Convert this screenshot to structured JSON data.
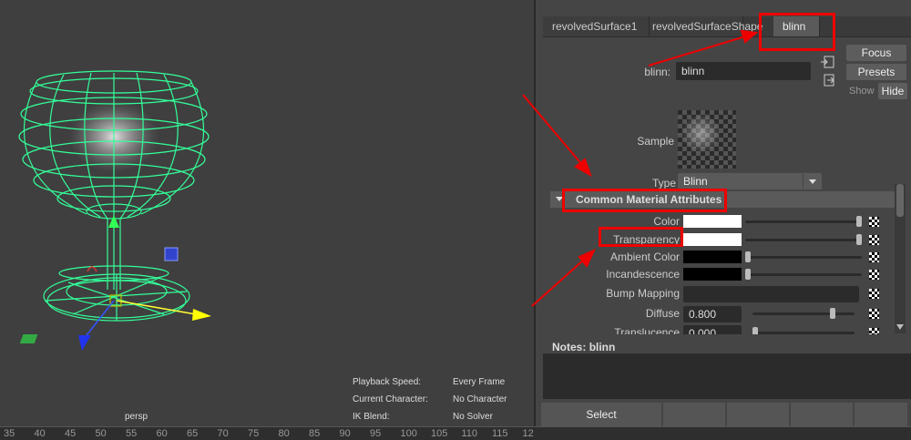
{
  "viewport": {
    "camera_label": "persp",
    "hud": [
      {
        "label": "Playback Speed:",
        "value": "Every Frame"
      },
      {
        "label": "Current Character:",
        "value": "No Character"
      },
      {
        "label": "IK Blend:",
        "value": "No Solver"
      }
    ]
  },
  "timeline": {
    "ticks": [
      "35",
      "40",
      "45",
      "50",
      "55",
      "60",
      "65",
      "70",
      "75",
      "80",
      "85",
      "90",
      "95",
      "100",
      "105",
      "110",
      "115",
      "12"
    ]
  },
  "attribute_editor": {
    "tabs": [
      "revolvedSurface1",
      "revolvedSurfaceShape",
      "blinn"
    ],
    "active_tab": "blinn",
    "node_label": "blinn:",
    "node_name": "blinn",
    "focus_label": "Focus",
    "presets_label": "Presets",
    "show_label": "Show",
    "hide_label": "Hide",
    "sample_label": "Sample",
    "type_label": "Type",
    "type_value": "Blinn",
    "section_title": "Common Material Attributes",
    "attributes": [
      {
        "label": "Color",
        "kind": "color",
        "color": "#ffffff",
        "slider": 1.0
      },
      {
        "label": "Transparency",
        "kind": "color",
        "color": "#ffffff",
        "slider": 1.0
      },
      {
        "label": "Ambient Color",
        "kind": "color",
        "color": "#000000",
        "slider": 0.0
      },
      {
        "label": "Incandescence",
        "kind": "color",
        "color": "#000000",
        "slider": 0.0
      },
      {
        "label": "Bump Mapping",
        "kind": "map",
        "value": ""
      },
      {
        "label": "Diffuse",
        "kind": "number",
        "value": "0.800",
        "slider": 0.8
      },
      {
        "label": "Translucence",
        "kind": "number",
        "value": "0.000",
        "slider": 0.0
      }
    ],
    "notes_label": "Notes:",
    "notes_node": "blinn",
    "bottom_buttons": [
      "Select",
      "",
      "",
      "",
      ""
    ]
  },
  "colors": {
    "wireframe": "#33ff99",
    "annotation": "#ee0000"
  }
}
